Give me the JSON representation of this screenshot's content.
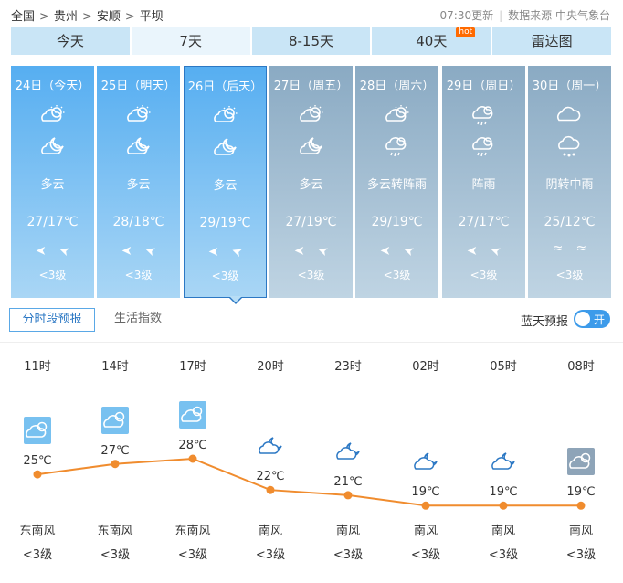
{
  "breadcrumb": {
    "items": [
      "全国",
      "贵州",
      "安顺",
      "平坝"
    ],
    "separator": ">"
  },
  "header": {
    "update_time": "07:30更新",
    "source": "数据来源 中央气象台"
  },
  "tabs": [
    {
      "label": "今天"
    },
    {
      "label": "7天",
      "active": true
    },
    {
      "label": "8-15天"
    },
    {
      "label": "40天",
      "badge": "hot"
    },
    {
      "label": "雷达图"
    }
  ],
  "days": [
    {
      "date": "24日（今天）",
      "icons": [
        "partly-cloudy-icon",
        "partly-cloudy-night-icon"
      ],
      "condition": "多云",
      "temp": "27/17℃",
      "wind": [
        "➤",
        "➤"
      ],
      "wind_level": "<3级",
      "style": "blue"
    },
    {
      "date": "25日（明天）",
      "icons": [
        "partly-cloudy-icon",
        "partly-cloudy-night-icon"
      ],
      "condition": "多云",
      "temp": "28/18℃",
      "wind": [
        "➤",
        "➤"
      ],
      "wind_level": "<3级",
      "style": "blue"
    },
    {
      "date": "26日（后天）",
      "icons": [
        "partly-cloudy-icon",
        "partly-cloudy-night-icon"
      ],
      "condition": "多云",
      "temp": "29/19℃",
      "wind": [
        "➤",
        "➤"
      ],
      "wind_level": "<3级",
      "style": "blue",
      "selected": true
    },
    {
      "date": "27日（周五）",
      "icons": [
        "partly-cloudy-icon",
        "partly-cloudy-night-icon"
      ],
      "condition": "多云",
      "temp": "27/19℃",
      "wind": [
        "➤",
        "➤"
      ],
      "wind_level": "<3级",
      "style": "gray"
    },
    {
      "date": "28日（周六）",
      "icons": [
        "partly-cloudy-icon",
        "shower-icon"
      ],
      "condition": "多云转阵雨",
      "temp": "29/19℃",
      "wind": [
        "➤",
        "➤"
      ],
      "wind_level": "<3级",
      "style": "gray"
    },
    {
      "date": "29日（周日）",
      "icons": [
        "shower-icon",
        "shower-icon"
      ],
      "condition": "阵雨",
      "temp": "27/17℃",
      "wind": [
        "➤",
        "➤"
      ],
      "wind_level": "<3级",
      "style": "gray"
    },
    {
      "date": "30日（周一）",
      "icons": [
        "overcast-icon",
        "rain-icon"
      ],
      "condition": "阴转中雨",
      "temp": "25/12℃",
      "wind": [
        "≈",
        "≈"
      ],
      "wind_level": "<3级",
      "style": "gray"
    }
  ],
  "subtabs": {
    "active": "分时段预报",
    "other": "生活指数"
  },
  "bluesky": {
    "label": "蓝天预报",
    "toggle": "开"
  },
  "hourly": {
    "times": [
      "11时",
      "14时",
      "17时",
      "20时",
      "23时",
      "02时",
      "05时",
      "08时"
    ],
    "temps": [
      25,
      27,
      28,
      22,
      21,
      19,
      19,
      19
    ],
    "temp_labels": [
      "25℃",
      "27℃",
      "28℃",
      "22℃",
      "21℃",
      "19℃",
      "19℃",
      "19℃"
    ],
    "icons": [
      "day-partly-cloudy-icon",
      "day-partly-cloudy-icon",
      "day-partly-cloudy-icon",
      "night-partly-cloudy-icon",
      "night-partly-cloudy-icon",
      "night-partly-cloudy-icon",
      "night-partly-cloudy-icon",
      "day-overcast-icon"
    ],
    "winds": [
      "东南风",
      "东南风",
      "东南风",
      "南风",
      "南风",
      "南风",
      "南风",
      "南风"
    ],
    "levels": [
      "<3级",
      "<3级",
      "<3级",
      "<3级",
      "<3级",
      "<3级",
      "<3级",
      "<3级"
    ],
    "line_color": "#f08c2e"
  }
}
